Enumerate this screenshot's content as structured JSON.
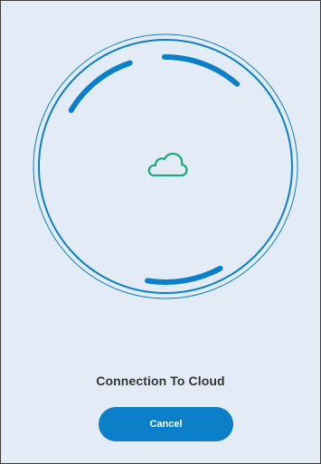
{
  "dialog": {
    "title": "Connection To Cloud",
    "cancel_label": "Cancel"
  },
  "icons": {
    "status_icon": "cloud-icon"
  },
  "colors": {
    "background": "#e3ecf6",
    "ring": "#0b80c8",
    "cloud": "#1fa67f",
    "title_text": "#333333",
    "button_bg": "#0b80c8",
    "button_text": "#ffffff"
  }
}
